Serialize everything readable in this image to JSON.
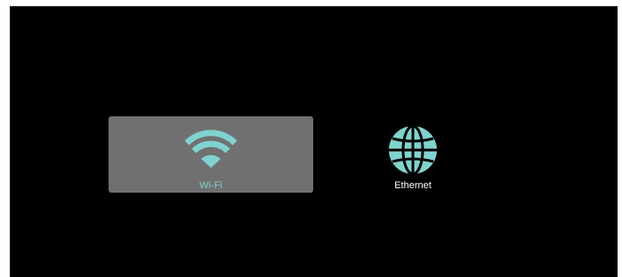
{
  "network_menu": {
    "items": [
      {
        "label": "Wi-Fi",
        "icon": "wifi-icon",
        "selected": true
      },
      {
        "label": "Ethernet",
        "icon": "globe-icon",
        "selected": false
      }
    ]
  },
  "colors": {
    "background": "#000000",
    "selected_tile": "#707070",
    "icon_accent": "#7fd3cf",
    "label_default": "#ffffff"
  }
}
